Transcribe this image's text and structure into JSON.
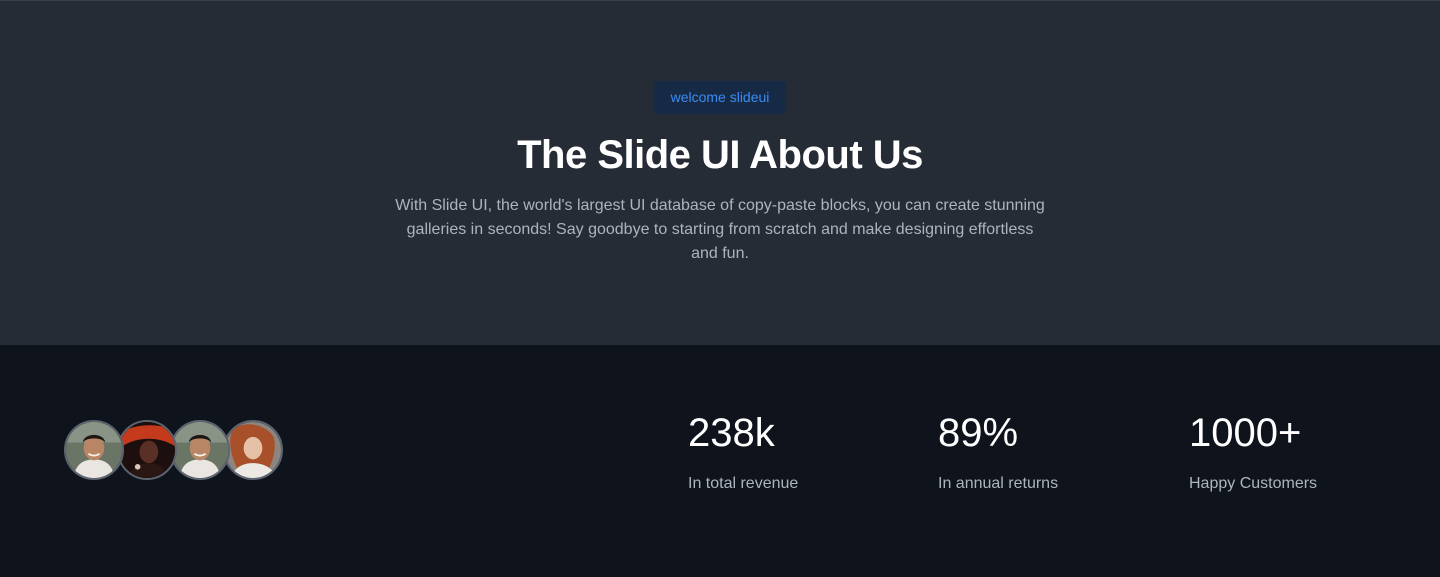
{
  "hero": {
    "badge": "welcome slideui",
    "title": "The Slide UI About Us",
    "description": "With Slide UI, the world's largest UI database of copy-paste blocks, you can create stunning galleries in seconds! Say goodbye to starting from scratch and make designing effortless and fun."
  },
  "avatars": [
    "avatar-man-photo",
    "avatar-woman-red-photo",
    "avatar-man-photo",
    "avatar-woman-auburn-photo"
  ],
  "stats": [
    {
      "value": "238k",
      "label": "In total revenue"
    },
    {
      "value": "89%",
      "label": "In annual returns"
    },
    {
      "value": "1000+",
      "label": "Happy Customers"
    }
  ],
  "colors": {
    "hero_bg": "#262c36",
    "stats_bg": "#0e131c",
    "accent": "#3b8cf2",
    "badge_bg": "#172a45",
    "muted_text": "#aeb4be"
  }
}
